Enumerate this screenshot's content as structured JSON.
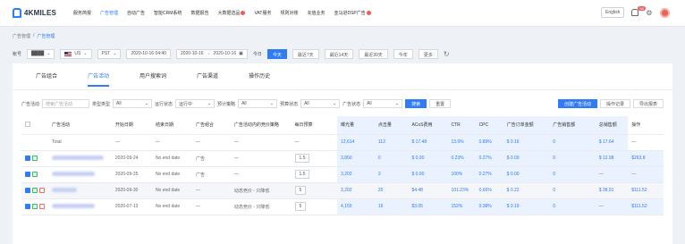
{
  "app": {
    "logo_text": "4KMILES",
    "nav": [
      "服务简报",
      "广告管理",
      "自动广告",
      "智能CRM系统",
      "数据报告",
      "大数据选品",
      "VAT服务",
      "规则对账",
      "充值业务",
      "亚马逊DSP广告"
    ],
    "language": "English",
    "notification_count": "58"
  },
  "breadcrumb": [
    "广告管理",
    "/",
    "广告管理"
  ],
  "controls": {
    "label": "帐号",
    "account_value": "████",
    "country": "US",
    "timezone": "PST",
    "report_time": "2020-10-16 04:40",
    "start_date": "2020-10-16",
    "arrow": "→",
    "end_date": "2020-10-16",
    "range_prefix": "今日",
    "ranges": [
      "今天",
      "最近7天",
      "最近14天",
      "最近30天",
      "今年",
      "更多"
    ],
    "refresh": "↻"
  },
  "tabs": [
    "广告组合",
    "广告活动",
    "用户搜索词",
    "广告渠道",
    "操作历史"
  ],
  "filters": {
    "campaign_label": "广告活动",
    "search_placeholder": "搜索广告活动",
    "type_label": "类型类型",
    "all": "All",
    "status_label": "运行状态",
    "status_value": "运行中",
    "budget_label": "预计策略",
    "target_label": "预算状态",
    "pause_label": "广告状态",
    "search_button": "搜索",
    "reset_button": "重置",
    "create_button": "创建广告活动",
    "batch_button": "操作记录",
    "export_button": "导出报表"
  },
  "table": {
    "headers": [
      "",
      "广告活动",
      "开始日期",
      "结束日期",
      "广告组合",
      "广告活动内的竞价策略",
      "每日预算",
      "曝光量",
      "点击量",
      "ACoS费用",
      "CTR",
      "CPC",
      "广告订单金额",
      "广告销售额",
      "总销售额",
      "操作"
    ],
    "summary": [
      "Total",
      "—",
      "—",
      "—",
      "—",
      "—",
      "12,614",
      "112",
      "$ 17.48",
      "13.9%",
      "0.89%",
      "$ 0.16",
      "0",
      "$ 17.64",
      "—"
    ],
    "rows": [
      {
        "start": "2020-09-24",
        "end": "No end date",
        "group": "广告",
        "strategy": "—",
        "budget": "1.5",
        "impressions": "3,850",
        "clicks": "0",
        "acos": "$ 0.00",
        "ctr": "0.23%",
        "rate": "0.27%",
        "cpc": "$ 0.00",
        "orders": "0",
        "sales": "$ 12.98",
        "total": "$263.8"
      },
      {
        "start": "2020-09-25",
        "end": "No end date",
        "group": "广告",
        "strategy": "—",
        "budget": "1.5",
        "impressions": "3,202",
        "clicks": "3",
        "acos": "$ 0.00",
        "ctr": "100%",
        "rate": "0.27%",
        "cpc": "$ 0.00",
        "orders": "0",
        "sales": "—",
        "total": "—"
      },
      {
        "start": "2020-09-30",
        "end": "No end date",
        "group": "—",
        "strategy": "动态竞价 - 只降低",
        "budget": "5",
        "impressions": "3,202",
        "clicks": "20",
        "acos": "$4.48",
        "ctr": "101.23%",
        "rate": "0.66%",
        "cpc": "$ 0.22",
        "orders": "0",
        "sales": "$ 38.91",
        "total": "$111.52"
      },
      {
        "start": "2020-07-13",
        "end": "No end date",
        "group": "—",
        "strategy": "动态竞价 - 只降低",
        "budget": "5",
        "impressions": "4,155",
        "clicks": "16",
        "acos": "$3.05",
        "ctr": "152%",
        "rate": "0.38%",
        "cpc": "$ 0.19",
        "orders": "0",
        "sales": "—",
        "total": "$111.52"
      }
    ]
  },
  "colors": {
    "accent": "#2f7cf6",
    "danger": "#f05b5b",
    "success": "#35b96b"
  }
}
